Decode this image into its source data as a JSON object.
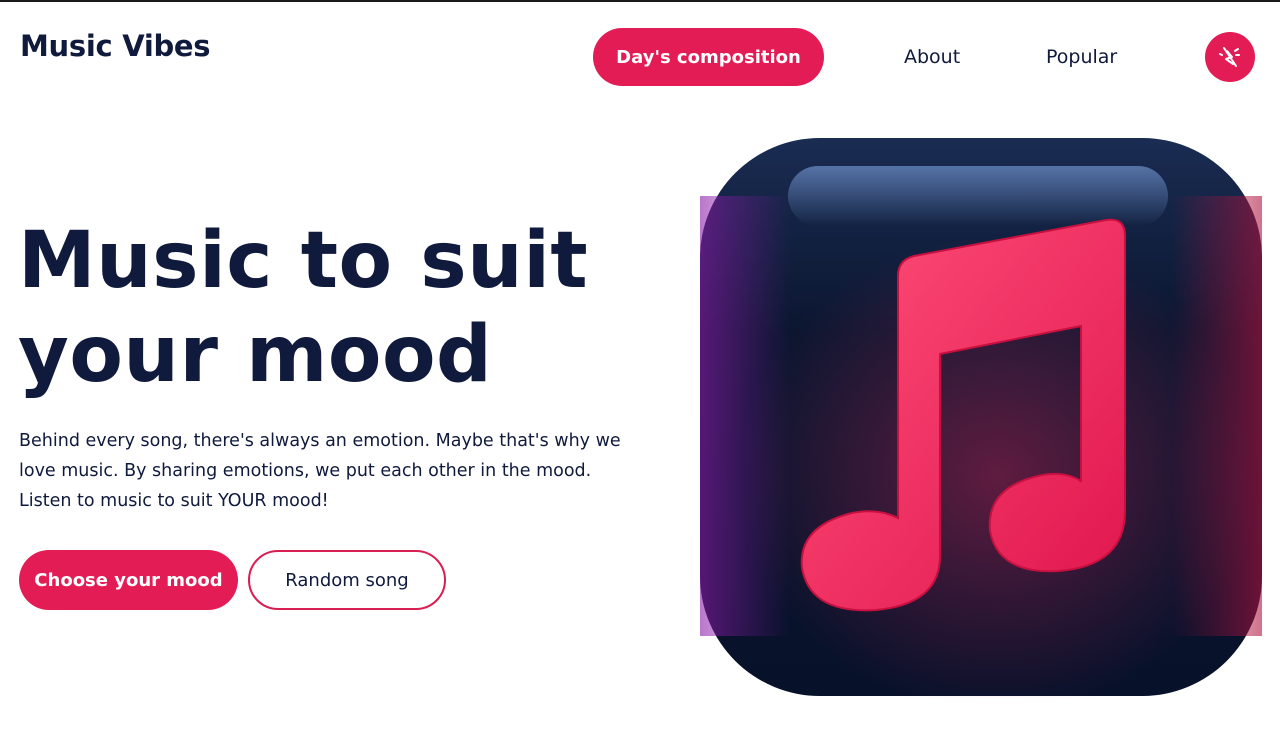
{
  "header": {
    "logo": "Music Vibes",
    "nav": {
      "featured": "Day's composition",
      "about": "About",
      "popular": "Popular"
    },
    "theme_toggle_icon": "light-off-icon"
  },
  "hero": {
    "title_line1": "Music to suit",
    "title_line2": "your mood",
    "description": "Behind every song, there's always an emotion. Maybe that's why we love music. By sharing emotions, we put each other in the mood. Listen to music to suit YOUR mood!",
    "primary_button": "Choose your mood",
    "secondary_button": "Random song",
    "image_icon": "music-note-icon"
  },
  "colors": {
    "accent": "#e31c56",
    "text": "#0f1a3c",
    "background": "#ffffff",
    "tile": "#0b1630"
  }
}
